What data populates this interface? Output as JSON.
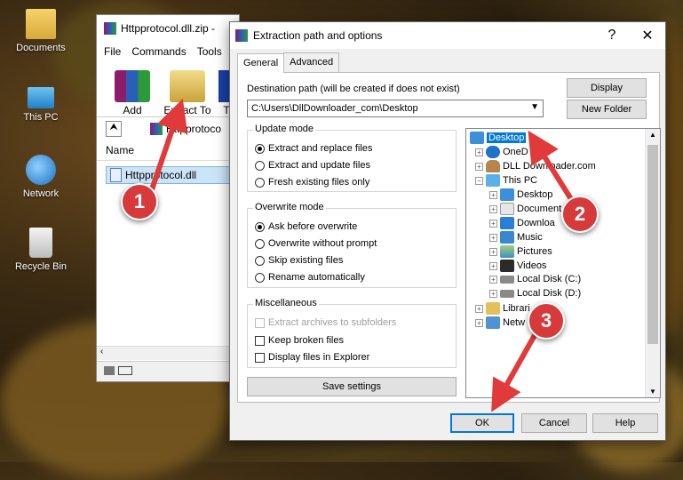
{
  "desktop": {
    "icons": [
      {
        "label": "Documents"
      },
      {
        "label": "This PC"
      },
      {
        "label": "Network"
      },
      {
        "label": "Recycle Bin"
      }
    ]
  },
  "winrar": {
    "title": "Httpprotocol.dll.zip -",
    "menu": [
      "File",
      "Commands",
      "Tools"
    ],
    "toolbar": {
      "add": "Add",
      "extract_to": "Extract To",
      "extra": "T"
    },
    "address": "Httpprotoco",
    "column": "Name",
    "file": "Httpprotocol.dll"
  },
  "dialog": {
    "title": "Extraction path and options",
    "help_glyph": "?",
    "close_glyph": "✕",
    "tabs": [
      "General",
      "Advanced"
    ],
    "dest_label": "Destination path (will be created if does not exist)",
    "dest_value": "C:\\Users\\DllDownloader_com\\Desktop",
    "display_btn": "Display",
    "new_folder_btn": "New Folder",
    "update_mode": {
      "title": "Update mode",
      "options": [
        "Extract and replace files",
        "Extract and update files",
        "Fresh existing files only"
      ],
      "selected": 0
    },
    "overwrite_mode": {
      "title": "Overwrite mode",
      "options": [
        "Ask before overwrite",
        "Overwrite without prompt",
        "Skip existing files",
        "Rename automatically"
      ],
      "selected": 0
    },
    "misc": {
      "title": "Miscellaneous",
      "options": [
        "Extract archives to subfolders",
        "Keep broken files",
        "Display files in Explorer"
      ]
    },
    "save_settings": "Save settings",
    "tree": {
      "desktop": "Desktop",
      "onedrive": "OneD",
      "dll": "DLL Downloader.com",
      "thispc": "This PC",
      "pc_children": [
        "Desktop",
        "Document",
        "Downloa",
        "Music",
        "Pictures",
        "Videos",
        "Local Disk (C:)",
        "Local Disk (D:)"
      ],
      "libraries": "Librari",
      "network": "Netw"
    },
    "ok": "OK",
    "cancel": "Cancel",
    "help": "Help"
  },
  "annotations": [
    "1",
    "2",
    "3"
  ],
  "colors": {
    "accent": "#0078d7",
    "badge": "#d63a3a"
  }
}
